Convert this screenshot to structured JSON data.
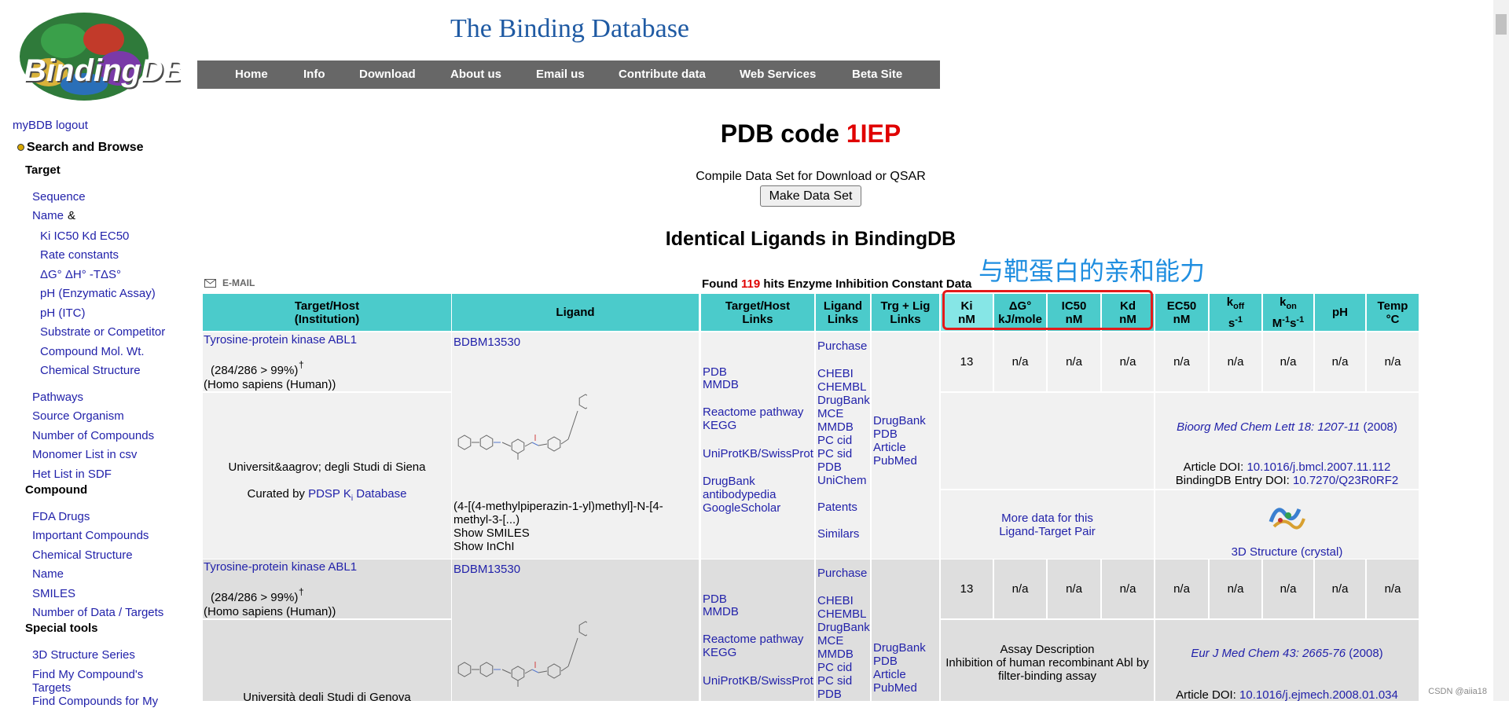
{
  "site": {
    "logo_text": "BindingDB",
    "title": "The Binding Database",
    "nav": [
      "Home",
      "Info",
      "Download",
      "About us",
      "Email us",
      "Contribute data",
      "Web Services",
      "Beta Site"
    ]
  },
  "sidebar": {
    "mybdb": "myBDB logout",
    "search_browse": "Search and Browse",
    "target_head": "Target",
    "target_items": [
      "Sequence",
      "Name"
    ],
    "name_amp": "&",
    "target_sub": [
      "Ki IC50 Kd EC50",
      "Rate constants",
      "ΔG° ΔH° -TΔS°",
      "pH (Enzymatic Assay)",
      "pH (ITC)",
      "Substrate or Competitor",
      "Compound Mol. Wt.",
      "Chemical Structure"
    ],
    "target_more": [
      "Pathways",
      "Source Organism",
      "Number of Compounds",
      "Monomer List in csv",
      "Het List in SDF"
    ],
    "compound_head": "Compound",
    "compound_items": [
      "FDA Drugs",
      "Important Compounds",
      "Chemical Structure",
      "Name",
      "SMILES",
      "Number of Data / Targets"
    ],
    "special_head": "Special tools",
    "special_items": [
      "3D Structure Series",
      "Find My Compound's",
      "Targets",
      "Find Compounds for My"
    ]
  },
  "page": {
    "pdb_label": "PDB code",
    "pdb_code": "1IEP",
    "compile_text": "Compile Data Set for Download or QSAR",
    "make_button": "Make Data Set",
    "identical_title": "Identical Ligands in BindingDB",
    "annotation": "与靶蛋白的亲和能力",
    "email_label": "E-MAIL",
    "found_prefix": "Found",
    "found_count": "119",
    "found_suffix": "hits Enzyme Inhibition Constant Data",
    "watermark": "CSDN @aiia18"
  },
  "table": {
    "headers": {
      "target": [
        "Target/Host",
        "(Institution)"
      ],
      "ligand": "Ligand",
      "thl": [
        "Target/Host",
        "Links"
      ],
      "ll": [
        "Ligand",
        "Links"
      ],
      "tll": [
        "Trg + Lig",
        "Links"
      ],
      "ki": [
        "Ki",
        "nM"
      ],
      "dg": [
        "ΔG°",
        "kJ/mole"
      ],
      "ic50": [
        "IC50",
        "nM"
      ],
      "kd": [
        "Kd",
        "nM"
      ],
      "ec50": [
        "EC50",
        "nM"
      ],
      "koff": [
        "k",
        "off",
        "s",
        "-1"
      ],
      "kon": [
        "k",
        "on",
        "M",
        "-1",
        "s",
        "-1"
      ],
      "ph": "pH",
      "temp": [
        "Temp",
        "°C"
      ]
    },
    "rows": [
      {
        "target": "Tyrosine-protein kinase ABL1",
        "coverage": "(284/286 > 99%)",
        "dagger": "†",
        "organism": "(Homo sapiens (Human))",
        "institution": "Universit&aagrov; degli Studi di Siena",
        "curated_prefix": "Curated by",
        "curated_link": "PDSP K",
        "curated_sub": "i",
        "curated_suffix": "Database",
        "ligand_id": "BDBM13530",
        "ligand_name": "(4-[(4-methylpiperazin-1-yl)methyl]-N-[4-methyl-3-[...)",
        "show_smiles": "Show SMILES",
        "show_inchi": "Show InChI",
        "thl_links": [
          "PDB",
          "MMDB",
          "Reactome pathway",
          "KEGG",
          "UniProtKB/SwissProt",
          "DrugBank",
          "antibodypedia",
          "GoogleScholar"
        ],
        "ll_links": [
          "Purchase",
          "CHEBI",
          "CHEMBL",
          "DrugBank",
          "MCE",
          "MMDB",
          "PC cid",
          "PC sid",
          "PDB",
          "UniChem",
          "Patents",
          "Similars"
        ],
        "tll_links": [
          "DrugBank",
          "PDB",
          "Article",
          "PubMed"
        ],
        "values": [
          "13",
          "n/a",
          "n/a",
          "n/a",
          "n/a",
          "n/a",
          "n/a",
          "n/a",
          "n/a"
        ],
        "citation_journal": "Bioorg Med Chem Lett",
        "citation_vol": "18: 1207-11",
        "citation_year": "(2008)",
        "article_doi_label": "Article DOI:",
        "article_doi": "10.1016/j.bmcl.2007.11.112",
        "entry_doi_label": "BindingDB Entry DOI:",
        "entry_doi": "10.7270/Q23R0RF2",
        "more_data": [
          "More data for this",
          "Ligand-Target Pair"
        ],
        "structure_link": "3D Structure (crystal)"
      },
      {
        "target": "Tyrosine-protein kinase ABL1",
        "coverage": "(284/286 > 99%)",
        "dagger": "†",
        "organism": "(Homo sapiens (Human))",
        "institution": "Università degli Studi di Genova",
        "ligand_id": "BDBM13530",
        "thl_links": [
          "PDB",
          "MMDB",
          "Reactome pathway",
          "KEGG",
          "UniProtKB/SwissProt"
        ],
        "ll_links": [
          "Purchase",
          "CHEBI",
          "CHEMBL",
          "DrugBank",
          "MCE",
          "MMDB",
          "PC cid",
          "PC sid",
          "PDB"
        ],
        "tll_links": [
          "DrugBank",
          "PDB",
          "Article",
          "PubMed"
        ],
        "values": [
          "13",
          "n/a",
          "n/a",
          "n/a",
          "n/a",
          "n/a",
          "n/a",
          "n/a",
          "n/a"
        ],
        "assay_label": "Assay Description",
        "assay_text": [
          "Inhibition of human recombinant Abl by",
          "filter-binding assay"
        ],
        "citation_journal": "Eur J Med Chem",
        "citation_vol": "43: 2665-76",
        "citation_year": "(2008)",
        "article_doi_label": "Article DOI:",
        "article_doi": "10.1016/j.ejmech.2008.01.034"
      }
    ]
  },
  "colors": {
    "header_teal": "#4bcbcb",
    "accent_red": "#e00000",
    "title_blue": "#1f5aa3",
    "annotation_blue": "#1f8ee0"
  }
}
